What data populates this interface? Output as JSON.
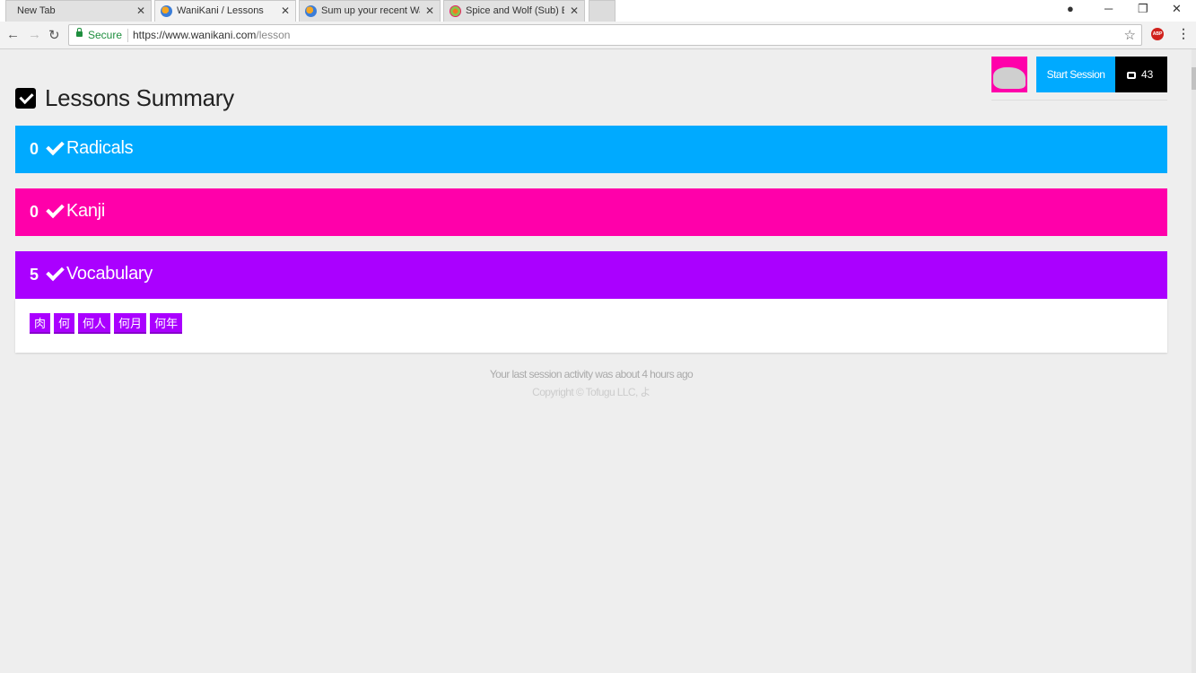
{
  "browser": {
    "tabs": [
      {
        "title": "New Tab",
        "close": "✕"
      },
      {
        "title": "WaniKani / Lessons",
        "close": "✕"
      },
      {
        "title": "Sum up your recent Wan",
        "close": "✕"
      },
      {
        "title": "Spice and Wolf (Sub) Epi",
        "close": "✕"
      }
    ],
    "secure_label": "Secure",
    "url_host": "https://www.wanikani.com",
    "url_path": "/lesson",
    "abp_label": "ABP"
  },
  "header": {
    "start_session_label": "Start Session",
    "review_count": "43"
  },
  "page": {
    "title": "Lessons Summary"
  },
  "categories": [
    {
      "count": "0",
      "label": "Radicals",
      "color": "#00aaff"
    },
    {
      "count": "0",
      "label": "Kanji",
      "color": "#ff00aa"
    },
    {
      "count": "5",
      "label": "Vocabulary",
      "color": "#aa00ff"
    }
  ],
  "vocabulary_items": [
    "肉",
    "何",
    "何人",
    "何月",
    "何年"
  ],
  "footer": {
    "activity": "Your last session activity was about 4 hours ago",
    "copyright": "Copyright © Tofugu LLC, よ"
  },
  "icons": {
    "tab_favicons": [
      "",
      "wanikani-icon",
      "wanikani-icon",
      "crunchyroll-icon"
    ],
    "title": "checkbox-checked-icon",
    "category": "checkmark-icon",
    "review": "inbox-icon"
  }
}
